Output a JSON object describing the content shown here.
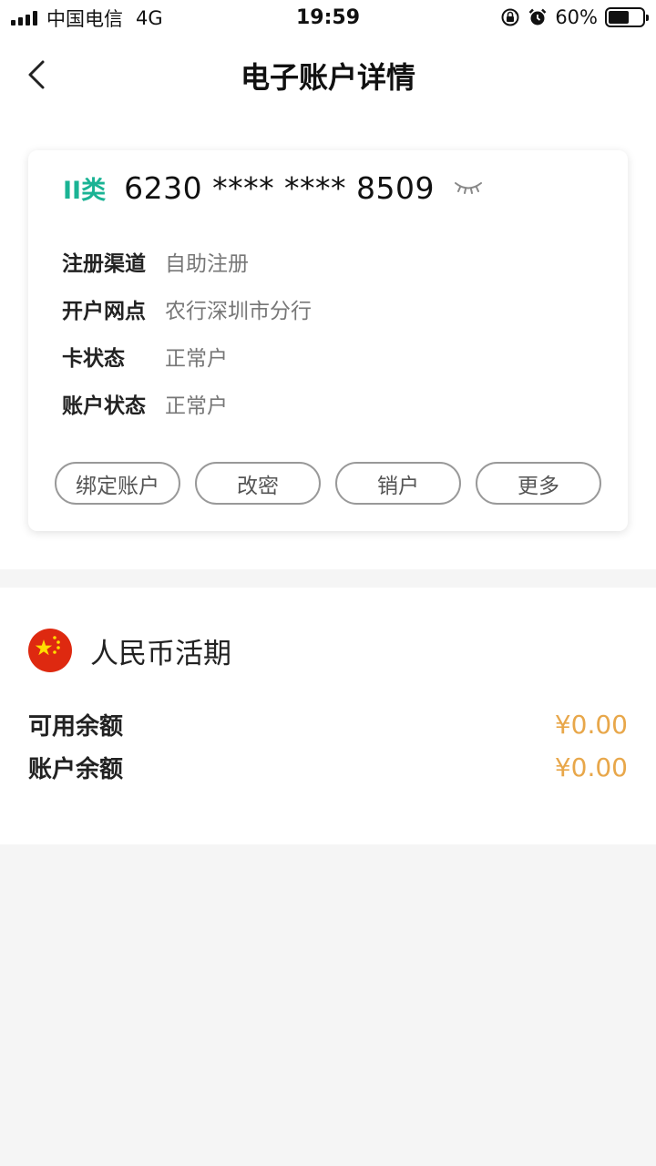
{
  "status_bar": {
    "carrier": "中国电信",
    "network": "4G",
    "time": "19:59",
    "battery_percent": "60%",
    "battery_level": 0.6
  },
  "nav": {
    "title": "电子账户详情"
  },
  "card": {
    "type_label": "II类",
    "number": "6230 **** **** 8509",
    "info": [
      {
        "label": "注册渠道",
        "value": "自助注册"
      },
      {
        "label": "开户网点",
        "value": "农行深圳市分行"
      },
      {
        "label": "卡状态",
        "value": "正常户"
      },
      {
        "label": "账户状态",
        "value": "正常户"
      }
    ],
    "actions": [
      "绑定账户",
      "改密",
      "销户",
      "更多"
    ]
  },
  "balance": {
    "currency": "人民币活期",
    "rows": [
      {
        "label": "可用余额",
        "value": "¥0.00"
      },
      {
        "label": "账户余额",
        "value": "¥0.00"
      }
    ]
  },
  "colors": {
    "accent_green": "#1ab394",
    "amount_orange": "#e8a74a",
    "flag_red": "#de2910",
    "flag_yellow": "#ffde00"
  }
}
